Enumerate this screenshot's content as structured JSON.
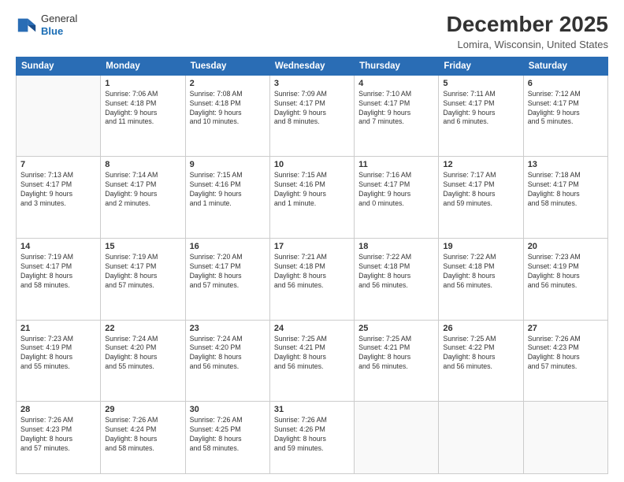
{
  "header": {
    "logo": {
      "general": "General",
      "blue": "Blue"
    },
    "title": "December 2025",
    "location": "Lomira, Wisconsin, United States"
  },
  "weekdays": [
    "Sunday",
    "Monday",
    "Tuesday",
    "Wednesday",
    "Thursday",
    "Friday",
    "Saturday"
  ],
  "weeks": [
    [
      {
        "day": "",
        "info": ""
      },
      {
        "day": "1",
        "info": "Sunrise: 7:06 AM\nSunset: 4:18 PM\nDaylight: 9 hours\nand 11 minutes."
      },
      {
        "day": "2",
        "info": "Sunrise: 7:08 AM\nSunset: 4:18 PM\nDaylight: 9 hours\nand 10 minutes."
      },
      {
        "day": "3",
        "info": "Sunrise: 7:09 AM\nSunset: 4:17 PM\nDaylight: 9 hours\nand 8 minutes."
      },
      {
        "day": "4",
        "info": "Sunrise: 7:10 AM\nSunset: 4:17 PM\nDaylight: 9 hours\nand 7 minutes."
      },
      {
        "day": "5",
        "info": "Sunrise: 7:11 AM\nSunset: 4:17 PM\nDaylight: 9 hours\nand 6 minutes."
      },
      {
        "day": "6",
        "info": "Sunrise: 7:12 AM\nSunset: 4:17 PM\nDaylight: 9 hours\nand 5 minutes."
      }
    ],
    [
      {
        "day": "7",
        "info": "Sunrise: 7:13 AM\nSunset: 4:17 PM\nDaylight: 9 hours\nand 3 minutes."
      },
      {
        "day": "8",
        "info": "Sunrise: 7:14 AM\nSunset: 4:17 PM\nDaylight: 9 hours\nand 2 minutes."
      },
      {
        "day": "9",
        "info": "Sunrise: 7:15 AM\nSunset: 4:16 PM\nDaylight: 9 hours\nand 1 minute."
      },
      {
        "day": "10",
        "info": "Sunrise: 7:15 AM\nSunset: 4:16 PM\nDaylight: 9 hours\nand 1 minute."
      },
      {
        "day": "11",
        "info": "Sunrise: 7:16 AM\nSunset: 4:17 PM\nDaylight: 9 hours\nand 0 minutes."
      },
      {
        "day": "12",
        "info": "Sunrise: 7:17 AM\nSunset: 4:17 PM\nDaylight: 8 hours\nand 59 minutes."
      },
      {
        "day": "13",
        "info": "Sunrise: 7:18 AM\nSunset: 4:17 PM\nDaylight: 8 hours\nand 58 minutes."
      }
    ],
    [
      {
        "day": "14",
        "info": "Sunrise: 7:19 AM\nSunset: 4:17 PM\nDaylight: 8 hours\nand 58 minutes."
      },
      {
        "day": "15",
        "info": "Sunrise: 7:19 AM\nSunset: 4:17 PM\nDaylight: 8 hours\nand 57 minutes."
      },
      {
        "day": "16",
        "info": "Sunrise: 7:20 AM\nSunset: 4:17 PM\nDaylight: 8 hours\nand 57 minutes."
      },
      {
        "day": "17",
        "info": "Sunrise: 7:21 AM\nSunset: 4:18 PM\nDaylight: 8 hours\nand 56 minutes."
      },
      {
        "day": "18",
        "info": "Sunrise: 7:22 AM\nSunset: 4:18 PM\nDaylight: 8 hours\nand 56 minutes."
      },
      {
        "day": "19",
        "info": "Sunrise: 7:22 AM\nSunset: 4:18 PM\nDaylight: 8 hours\nand 56 minutes."
      },
      {
        "day": "20",
        "info": "Sunrise: 7:23 AM\nSunset: 4:19 PM\nDaylight: 8 hours\nand 56 minutes."
      }
    ],
    [
      {
        "day": "21",
        "info": "Sunrise: 7:23 AM\nSunset: 4:19 PM\nDaylight: 8 hours\nand 55 minutes."
      },
      {
        "day": "22",
        "info": "Sunrise: 7:24 AM\nSunset: 4:20 PM\nDaylight: 8 hours\nand 55 minutes."
      },
      {
        "day": "23",
        "info": "Sunrise: 7:24 AM\nSunset: 4:20 PM\nDaylight: 8 hours\nand 56 minutes."
      },
      {
        "day": "24",
        "info": "Sunrise: 7:25 AM\nSunset: 4:21 PM\nDaylight: 8 hours\nand 56 minutes."
      },
      {
        "day": "25",
        "info": "Sunrise: 7:25 AM\nSunset: 4:21 PM\nDaylight: 8 hours\nand 56 minutes."
      },
      {
        "day": "26",
        "info": "Sunrise: 7:25 AM\nSunset: 4:22 PM\nDaylight: 8 hours\nand 56 minutes."
      },
      {
        "day": "27",
        "info": "Sunrise: 7:26 AM\nSunset: 4:23 PM\nDaylight: 8 hours\nand 57 minutes."
      }
    ],
    [
      {
        "day": "28",
        "info": "Sunrise: 7:26 AM\nSunset: 4:23 PM\nDaylight: 8 hours\nand 57 minutes."
      },
      {
        "day": "29",
        "info": "Sunrise: 7:26 AM\nSunset: 4:24 PM\nDaylight: 8 hours\nand 58 minutes."
      },
      {
        "day": "30",
        "info": "Sunrise: 7:26 AM\nSunset: 4:25 PM\nDaylight: 8 hours\nand 58 minutes."
      },
      {
        "day": "31",
        "info": "Sunrise: 7:26 AM\nSunset: 4:26 PM\nDaylight: 8 hours\nand 59 minutes."
      },
      {
        "day": "",
        "info": ""
      },
      {
        "day": "",
        "info": ""
      },
      {
        "day": "",
        "info": ""
      }
    ]
  ]
}
